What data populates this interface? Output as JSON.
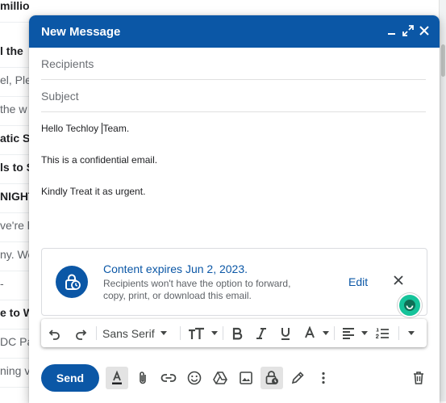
{
  "inbox": {
    "rows": [
      {
        "text": "millio",
        "style": "bold"
      },
      {
        "text": "l the",
        "style": "bold"
      },
      {
        "text": "el, Ple",
        "style": "light"
      },
      {
        "text": "the w",
        "style": "light"
      },
      {
        "text": "atic S",
        "style": "bold"
      },
      {
        "text": "ls to S",
        "style": "bold"
      },
      {
        "text": "NIGHT",
        "style": "bold"
      },
      {
        "text": "ve're h",
        "style": "light"
      },
      {
        "text": "ny. We",
        "style": "light"
      },
      {
        "text": "-",
        "style": "light"
      },
      {
        "text": "e to W",
        "style": "bold"
      },
      {
        "text": "DC Pa",
        "style": "light"
      },
      {
        "text": "ning v",
        "style": "light"
      }
    ]
  },
  "compose": {
    "title": "New Message",
    "recipients_placeholder": "Recipients",
    "subject_placeholder": "Subject",
    "body": {
      "line1_before": "Hello Techloy ",
      "line1_after": "Team.",
      "line2": "This is a confidential email.",
      "line3": "Kindly Treat it as urgent."
    },
    "confidential": {
      "title": "Content expires Jun 2, 2023.",
      "description": "Recipients won't have the option to forward, copy, print, or download this email.",
      "edit_label": "Edit"
    },
    "toolbar": {
      "font": "Sans Serif"
    },
    "send_label": "Send"
  },
  "colors": {
    "accent": "#0b57a6",
    "grammarly": "#15c39a"
  },
  "icons": [
    "minimize-icon",
    "expand-icon",
    "close-icon",
    "undo-icon",
    "redo-icon",
    "text-size-icon",
    "bold-icon",
    "italic-icon",
    "underline-icon",
    "text-color-icon",
    "align-icon",
    "numbered-list-icon",
    "more-formatting-icon",
    "formatting-options-icon",
    "attach-icon",
    "link-icon",
    "emoji-icon",
    "drive-icon",
    "photo-icon",
    "confidential-mode-icon",
    "signature-icon",
    "more-options-icon",
    "trash-icon"
  ]
}
